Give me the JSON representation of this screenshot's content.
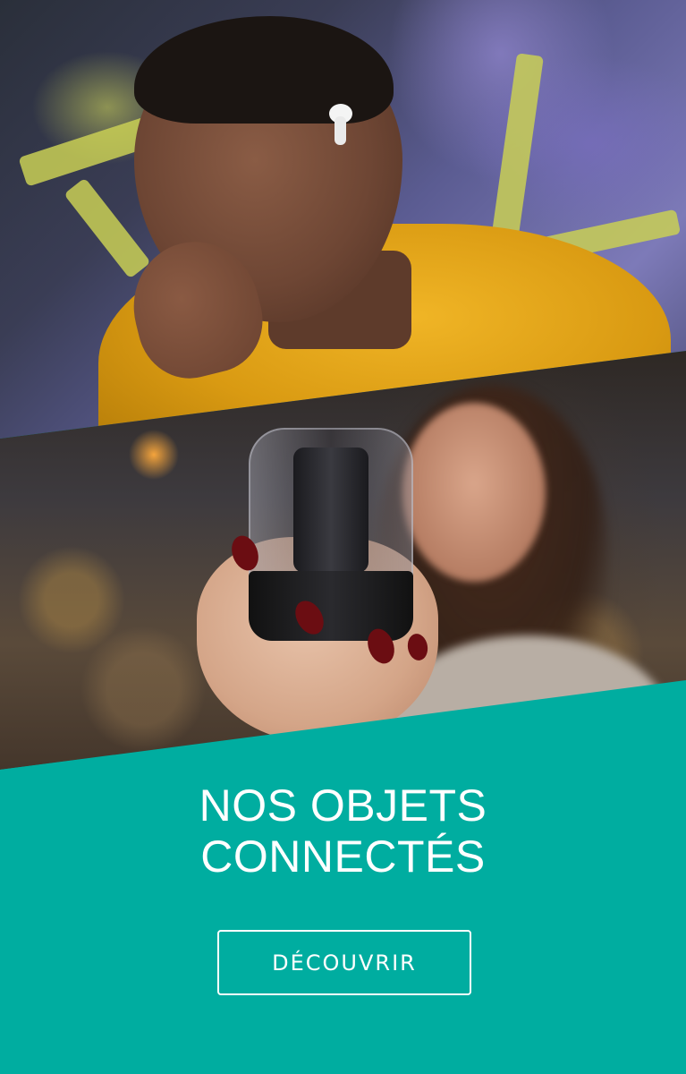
{
  "banner": {
    "headline_line1": "NOS OBJETS",
    "headline_line2": "CONNECTÉS",
    "cta_label": "DÉCOUVRIR"
  },
  "colors": {
    "accent_teal": "#00ADA0",
    "text": "#FFFFFF"
  }
}
